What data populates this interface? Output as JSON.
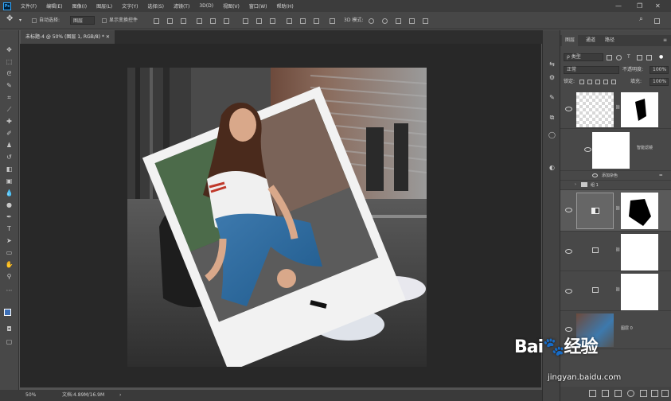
{
  "app": {
    "logo": "Ps",
    "accent": "#31a8ff"
  },
  "menu": [
    "文件(F)",
    "编辑(E)",
    "图像(I)",
    "图层(L)",
    "文字(Y)",
    "选择(S)",
    "滤镜(T)",
    "3D(D)",
    "视图(V)",
    "窗口(W)",
    "帮助(H)"
  ],
  "window_controls": {
    "minimize": "—",
    "restore": "❐",
    "close": "✕"
  },
  "options": {
    "auto_select_label": "自动选择:",
    "auto_select_value": "图层",
    "show_transform_label": "显示变换控件",
    "threed_mode": "3D 模式:"
  },
  "document": {
    "tab_title": "未标题-4 @ 50% (图层 1, RGB/8) *"
  },
  "status": {
    "zoom": "50%",
    "doc_info": "文档:4.89M/16.9M"
  },
  "panel": {
    "tabs": [
      "图层",
      "通道",
      "路径"
    ],
    "filter_kind": "ρ 类型",
    "blend_mode": "正常",
    "opacity_label": "不透明度:",
    "opacity_value": "100%",
    "lock_label": "锁定:",
    "fill_label": "填充:",
    "fill_value": "100%",
    "layers": [
      {
        "name": "",
        "kind": "transparent-with-mask"
      },
      {
        "name": "智能滤镜",
        "kind": "smart-filter"
      },
      {
        "name": "添加杂色",
        "kind": "filter-entry"
      },
      {
        "name": "组 1",
        "kind": "group"
      },
      {
        "name": "",
        "kind": "adjustment-with-mask"
      },
      {
        "name": "",
        "kind": "adjustment-white"
      },
      {
        "name": "",
        "kind": "adjustment-white"
      },
      {
        "name": "图层 0",
        "kind": "photo"
      }
    ]
  },
  "watermark": {
    "logo_text": "Bai🐾经验",
    "url": "jingyan.baidu.com"
  }
}
